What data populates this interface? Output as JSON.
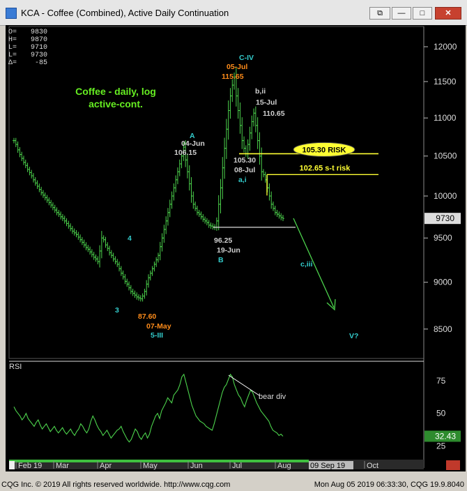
{
  "window": {
    "title": "KCA - Coffee (Combined), Active Daily Continuation",
    "buttons": [
      "⧉",
      "—",
      "□",
      "✕"
    ]
  },
  "ohlc_box": [
    "O=",
    "H=",
    "L=",
    "L=",
    "Δ="
  ],
  "ohlc_values": [
    "9830",
    "9870",
    "9710",
    "9730",
    "-85"
  ],
  "footer": {
    "left": "CQG Inc. © 2019 All rights reserved worldwide. http://www.cqg.com",
    "right": "Mon Aug 05 2019 06:33:30, CQG 19.9.8040"
  },
  "colors": {
    "background": "#000000",
    "bars": "#4cd24c",
    "annotation_green": "#66ee22",
    "orange": "#ff8c1a",
    "cyan": "#33cccc",
    "white_label": "#d0d0d0",
    "yellow": "#ffff33",
    "price_label_bg": "#dddddd"
  },
  "chart_data": [
    {
      "type": "bar",
      "subtype": "ohlc",
      "title": "Coffee - daily, log active-cont.",
      "y_scale": "log",
      "y_ticks": [
        12000,
        11500,
        11000,
        10500,
        10000,
        9500,
        9000,
        8500
      ],
      "ylim": [
        8200,
        12300
      ],
      "x_tick_labels": [
        "Feb 19",
        "Mar",
        "Apr",
        "May",
        "Jun",
        "Jul",
        "Aug",
        "09 Sep 19",
        "Oct"
      ],
      "last_price": "9730",
      "closes": [
        10700,
        10650,
        10580,
        10520,
        10470,
        10420,
        10380,
        10330,
        10290,
        10250,
        10200,
        10160,
        10120,
        10080,
        10040,
        10010,
        9980,
        9950,
        9920,
        9890,
        9860,
        9830,
        9800,
        9780,
        9750,
        9730,
        9700,
        9670,
        9640,
        9610,
        9580,
        9560,
        9540,
        9510,
        9480,
        9450,
        9420,
        9390,
        9370,
        9340,
        9310,
        9280,
        9260,
        9230,
        9350,
        9500,
        9480,
        9420,
        9380,
        9330,
        9300,
        9260,
        9230,
        9200,
        9150,
        9100,
        9060,
        9010,
        8980,
        8940,
        8900,
        8880,
        8860,
        8840,
        8830,
        8820,
        8850,
        8900,
        8980,
        9050,
        9100,
        9150,
        9200,
        9250,
        9300,
        9400,
        9500,
        9600,
        9700,
        9800,
        9900,
        10000,
        10100,
        10200,
        10300,
        10400,
        10500,
        10615,
        10450,
        10300,
        10150,
        10000,
        9900,
        9850,
        9800,
        9780,
        9750,
        9720,
        9700,
        9680,
        9650,
        9640,
        9630,
        9625,
        9700,
        9900,
        10100,
        10350,
        10600,
        10850,
        11100,
        11300,
        11450,
        11565,
        11300,
        11100,
        10900,
        10700,
        10600,
        10530,
        10650,
        10800,
        10950,
        11065,
        10900,
        10700,
        10500,
        10300,
        10265,
        10200,
        10100,
        10000,
        9900,
        9850,
        9800,
        9780,
        9760,
        9740,
        9730
      ],
      "levels": [
        {
          "label": "105.30 RISK",
          "value": 10530,
          "color": "yellow"
        },
        {
          "label": "102.65 s-t risk",
          "value": 10265,
          "color": "yellow"
        },
        {
          "label": "",
          "value": 9625,
          "color": "white"
        }
      ],
      "annotations": [
        {
          "text": "C-IV",
          "color": "cyan"
        },
        {
          "text": "05-Jul",
          "color": "orange"
        },
        {
          "text": "115.65",
          "color": "orange"
        },
        {
          "text": "b,ii",
          "color": "white"
        },
        {
          "text": "15-Jul",
          "color": "white"
        },
        {
          "text": "110.65",
          "color": "white"
        },
        {
          "text": "A",
          "color": "cyan"
        },
        {
          "text": "04-Jun",
          "color": "white"
        },
        {
          "text": "106.15",
          "color": "white"
        },
        {
          "text": "105.30",
          "color": "white"
        },
        {
          "text": "08-Jul",
          "color": "white"
        },
        {
          "text": "a,i",
          "color": "cyan"
        },
        {
          "text": "96.25",
          "color": "white"
        },
        {
          "text": "19-Jun",
          "color": "white"
        },
        {
          "text": "B",
          "color": "cyan"
        },
        {
          "text": "4",
          "color": "cyan"
        },
        {
          "text": "3",
          "color": "cyan"
        },
        {
          "text": "87.60",
          "color": "orange"
        },
        {
          "text": "07-May",
          "color": "orange"
        },
        {
          "text": "5-III",
          "color": "cyan"
        },
        {
          "text": "c,iii",
          "color": "cyan"
        },
        {
          "text": "V?",
          "color": "cyan"
        }
      ]
    },
    {
      "type": "line",
      "title": "RSI",
      "y_ticks": [
        75,
        50,
        25
      ],
      "ylim": [
        15,
        90
      ],
      "last_value": "32.43",
      "values": [
        55,
        52,
        50,
        48,
        45,
        47,
        50,
        46,
        44,
        42,
        40,
        43,
        45,
        41,
        38,
        40,
        42,
        39,
        36,
        38,
        40,
        37,
        35,
        37,
        39,
        36,
        34,
        36,
        38,
        35,
        33,
        36,
        38,
        42,
        40,
        37,
        35,
        38,
        44,
        48,
        45,
        41,
        38,
        36,
        33,
        35,
        37,
        34,
        31,
        33,
        35,
        37,
        38,
        40,
        36,
        33,
        30,
        28,
        30,
        34,
        38,
        36,
        32,
        30,
        33,
        35,
        31,
        34,
        40,
        44,
        48,
        50,
        46,
        52,
        55,
        58,
        62,
        60,
        58,
        64,
        66,
        68,
        72,
        78,
        80,
        74,
        68,
        62,
        56,
        52,
        48,
        46,
        44,
        43,
        42,
        40,
        39,
        38,
        37,
        42,
        48,
        54,
        60,
        66,
        70,
        72,
        76,
        80,
        78,
        72,
        68,
        64,
        62,
        58,
        55,
        60,
        64,
        68,
        66,
        62,
        58,
        55,
        52,
        50,
        48,
        46,
        44,
        40,
        37,
        36,
        35,
        33,
        34,
        32.43
      ],
      "annotations": [
        {
          "text": "bear div",
          "color": "white"
        }
      ]
    }
  ]
}
